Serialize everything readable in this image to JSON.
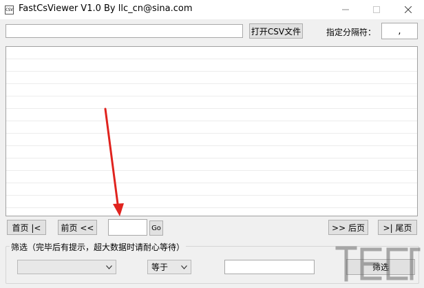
{
  "window": {
    "title": "FastCsViewer V1.0     By llc_cn@sina.com",
    "app_icon_text": "CSV"
  },
  "toolbar": {
    "path_value": "",
    "open_button_label": "打开CSV文件",
    "separator_label": "指定分隔符：",
    "separator_value": ","
  },
  "pagination": {
    "first_label": "首页 |<",
    "prev_label": "前页 <<",
    "page_value": "",
    "go_label": "Go",
    "next_label": ">> 后页",
    "last_label": ">| 尾页"
  },
  "filter": {
    "group_label": "筛选（完毕后有提示，超大数据时请耐心等待）",
    "column_value": "",
    "operator_value": "等于",
    "filter_value": "",
    "filter_button_label": "筛选"
  },
  "colors": {
    "arrow": "#e0231e",
    "accent": "#0078d7"
  }
}
